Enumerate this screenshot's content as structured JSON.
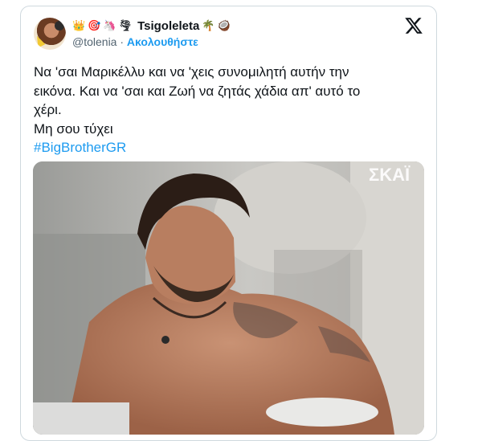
{
  "tweet": {
    "display_name": "Tsigoleleta",
    "handle": "@tolenia",
    "separator": "·",
    "follow_label": "Ακολουθήστε",
    "name_emojis": [
      "👑",
      "🎯",
      "🦄",
      "🌪",
      "🌴",
      "🥥"
    ],
    "body_lines": [
      "Να 'σαι Μαρικέλλυ και να 'χεις συνομιλητή αυτήν την",
      "εικόνα. Και να 'σαι και Ζωή να ζητάς χάδια απ' αυτό το",
      "χέρι.",
      "Μη σου τύχει"
    ],
    "hashtag": "#BigBrotherGR",
    "media_watermark": "ΣΚΑΪ"
  },
  "colors": {
    "text": "#0f1419",
    "secondary": "#536471",
    "link": "#1d9bf0",
    "border": "#cfd9de"
  },
  "icons": {
    "brand": "x-logo-icon"
  }
}
